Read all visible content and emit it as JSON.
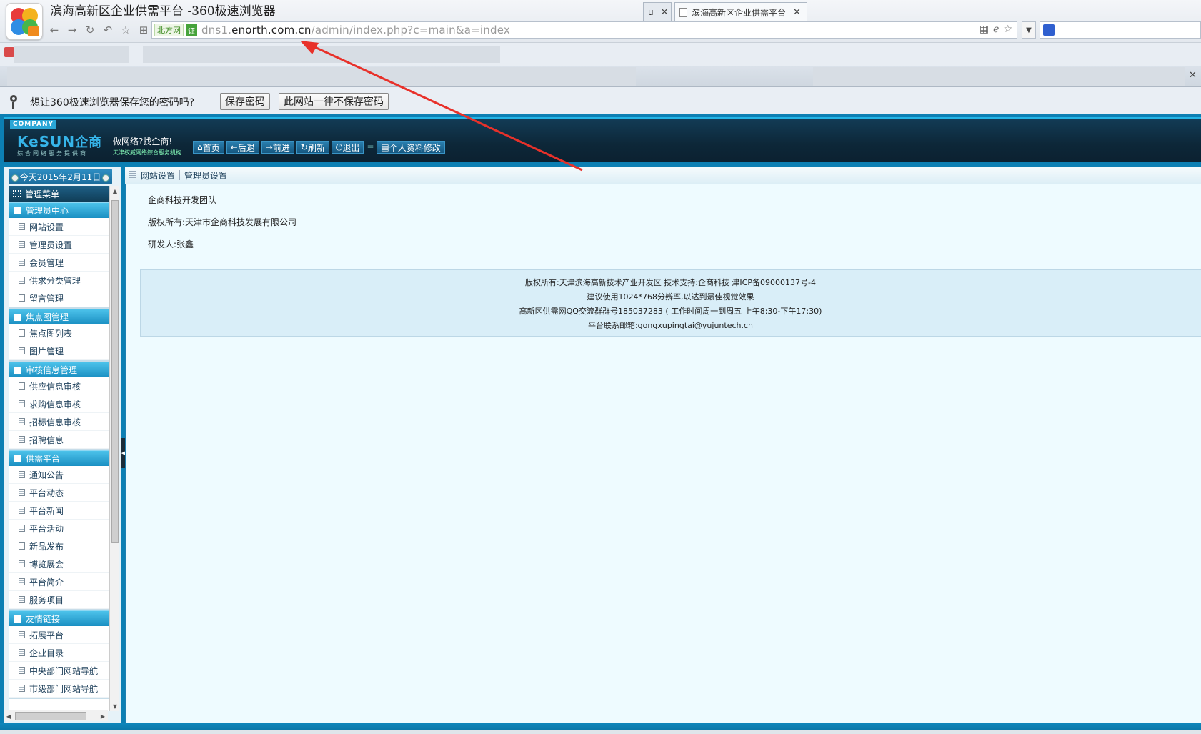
{
  "browser": {
    "window_title": "滨海高新区企业供需平台 -360极速浏览器",
    "address": {
      "site_label": "北方网",
      "cert_label": "证",
      "url_prefix": "dns1.",
      "url_domain": "enorth.com.cn",
      "url_path": "/admin/index.php?c=main&a=index"
    },
    "tabs": [
      {
        "label": "u"
      },
      {
        "label": "滨海高新区企业供需平台"
      }
    ],
    "password_prompt": {
      "message": "想让360极速浏览器保存您的密码吗?",
      "save_label": "保存密码",
      "never_label": "此网站一律不保存密码"
    }
  },
  "header": {
    "company_tag": "COMPANY",
    "logo_text": "KeSUN",
    "logo_cn": "企商",
    "logo_sub": "综合网络服务提供商",
    "slogan": "做网络?找企商!",
    "slogan_sub": "天津权威网络综合服务机构",
    "nav": [
      {
        "label": "首页",
        "icon": "home-icon"
      },
      {
        "label": "后退",
        "icon": "back-arrow-icon"
      },
      {
        "label": "前进",
        "icon": "forward-arrow-icon"
      },
      {
        "label": "刷新",
        "icon": "refresh-icon"
      },
      {
        "label": "退出",
        "icon": "power-icon"
      }
    ],
    "profile_label": "个人资料修改"
  },
  "sidebar": {
    "date": "今天2015年2月11日",
    "menu_title": "管理菜单",
    "groups": [
      {
        "title": "管理员中心",
        "items": [
          "网站设置",
          "管理员设置",
          "会员管理",
          "供求分类管理",
          "留言管理"
        ]
      },
      {
        "title": "焦点图管理",
        "items": [
          "焦点图列表",
          "图片管理"
        ]
      },
      {
        "title": "审核信息管理",
        "items": [
          "供应信息审核",
          "求购信息审核",
          "招标信息审核",
          "招聘信息"
        ]
      },
      {
        "title": "供需平台",
        "items": [
          "通知公告",
          "平台动态",
          "平台新闻",
          "平台活动",
          "新品发布",
          "博览展会",
          "平台简介",
          "服务项目"
        ]
      },
      {
        "title": "友情链接",
        "items": [
          "拓展平台",
          "企业目录",
          "中央部门网站导航",
          "市级部门网站导航"
        ]
      }
    ]
  },
  "breadcrumb": [
    "网站设置",
    "管理员设置"
  ],
  "main": {
    "lines": [
      "企商科技开发团队",
      "版权所有:天津市企商科技发展有限公司",
      "研发人:张鑫"
    ],
    "footer": [
      "版权所有:天津滨海高新技术产业开发区 技术支持:企商科技 津ICP备09000137号-4",
      "建议使用1024*768分辨率,以达到最佳视觉效果",
      "高新区供需网QQ交流群群号185037283 ( 工作时间周一到周五 上午8:30-下午17:30)",
      "平台联系邮箱:gongxupingtai@yujuntech.cn"
    ]
  },
  "colors": {
    "accent": "#1a8fc2",
    "frame": "#0c7fb3",
    "annotation_arrow": "#e8312a"
  }
}
